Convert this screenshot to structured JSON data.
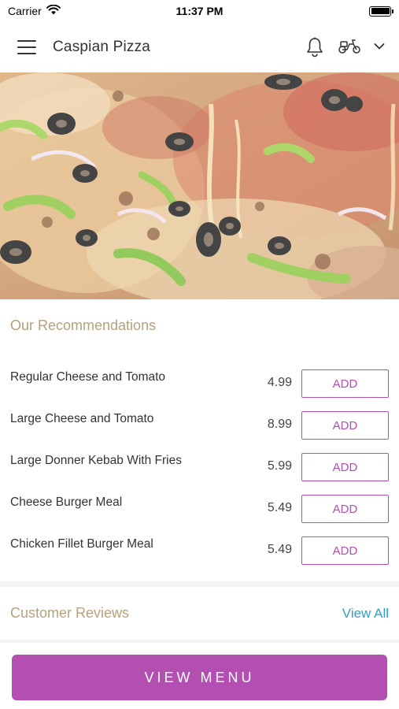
{
  "status_bar": {
    "carrier": "Carrier",
    "time": "11:37 PM"
  },
  "header": {
    "title": "Caspian Pizza",
    "icons": [
      "menu-icon",
      "bell-icon",
      "scooter-icon",
      "chevron-down-icon"
    ]
  },
  "hero": {
    "image": "pizza-photo"
  },
  "recommendations": {
    "title": "Our Recommendations",
    "items": [
      {
        "name": "Regular Cheese and Tomato",
        "price": "4.99",
        "action": "ADD"
      },
      {
        "name": "Large Cheese and Tomato",
        "price": "8.99",
        "action": "ADD"
      },
      {
        "name": "Large Donner Kebab With Fries",
        "price": "5.99",
        "action": "ADD"
      },
      {
        "name": "Cheese Burger Meal",
        "price": "5.49",
        "action": "ADD"
      },
      {
        "name": "Chicken Fillet Burger Meal",
        "price": "5.49",
        "action": "ADD"
      }
    ]
  },
  "reviews": {
    "title": "Customer Reviews",
    "view_all": "View All"
  },
  "footer": {
    "view_menu": "VIEW MENU"
  },
  "colors": {
    "accent": "#b24fb0",
    "section_title": "#b5a27a",
    "link": "#2e9fca"
  }
}
